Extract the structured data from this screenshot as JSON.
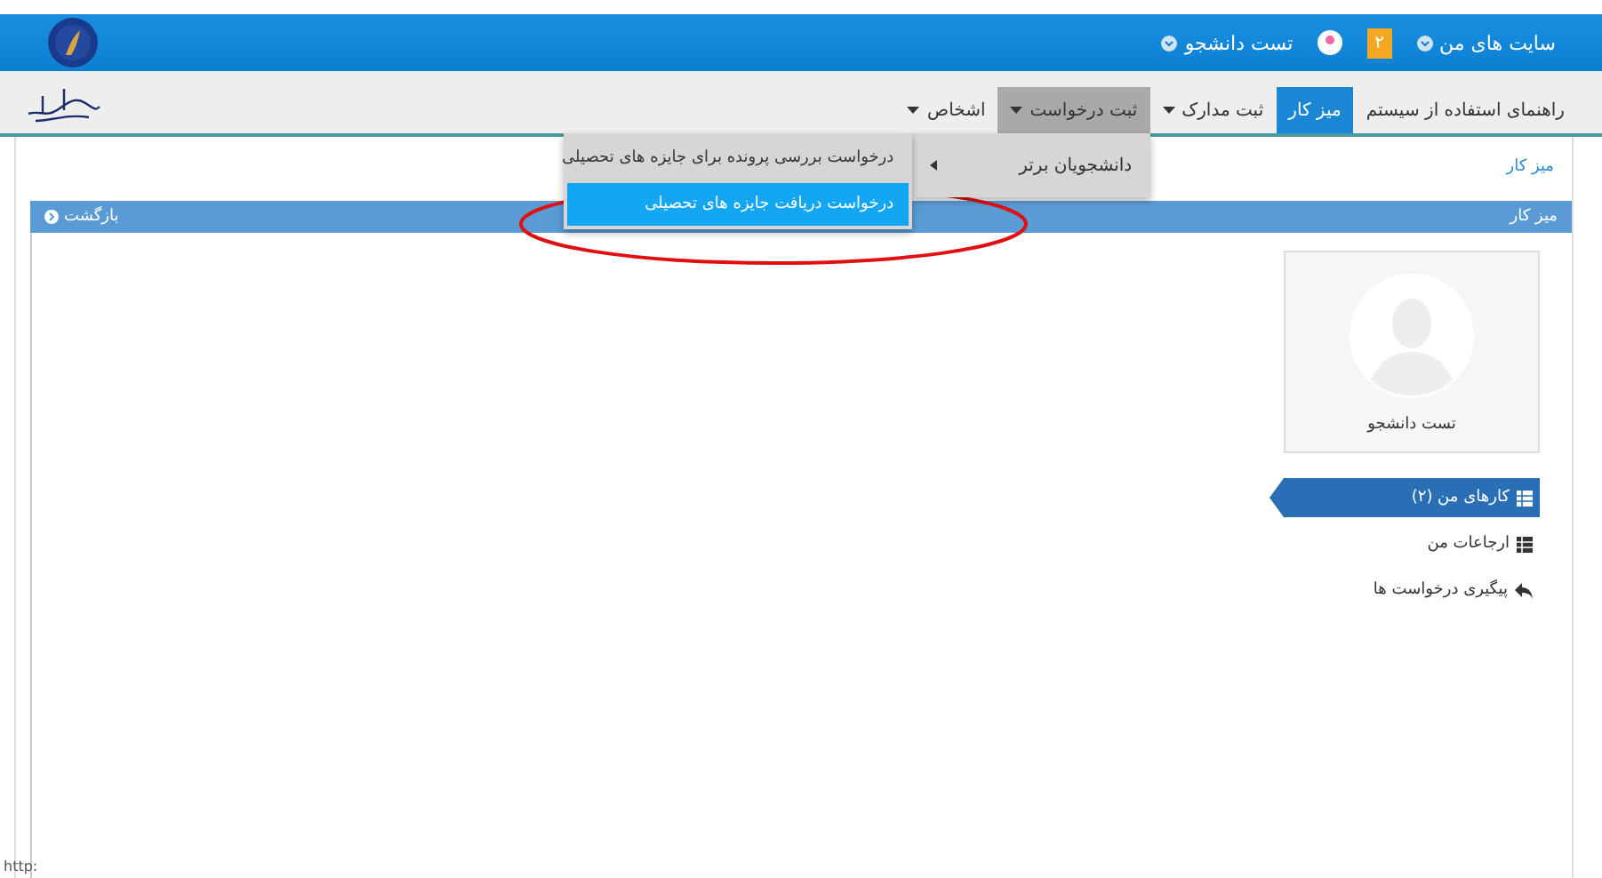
{
  "top_bar": {
    "items": [
      {
        "kind": "menu",
        "label": "سایت های من"
      },
      {
        "kind": "badge",
        "label": "۲"
      },
      {
        "kind": "user",
        "label": "تست دانشجو"
      }
    ]
  },
  "nav": {
    "tabs": [
      {
        "label": "راهنمای استفاده از سیستم",
        "selected": false,
        "dropdown": false,
        "open": false
      },
      {
        "label": "میز کار",
        "selected": true,
        "dropdown": false,
        "open": false
      },
      {
        "label": "ثبت مدارک",
        "selected": false,
        "dropdown": true,
        "open": false
      },
      {
        "label": "ثبت درخواست",
        "selected": false,
        "dropdown": true,
        "open": true
      },
      {
        "label": "اشخاص",
        "selected": false,
        "dropdown": true,
        "open": false
      }
    ]
  },
  "dropdown_menu": {
    "items": [
      {
        "label": "دانشجویان برتر",
        "submenu": [
          {
            "label": "درخواست بررسی پرونده برای جایزه های تحصیلی",
            "selected": false
          },
          {
            "label": "درخواست دریافت جایزه های تحصیلی",
            "selected": true
          }
        ]
      }
    ]
  },
  "breadcrumb": "میز کار",
  "panel": {
    "title": "میز کار",
    "back_button": "بازگشت"
  },
  "profile": {
    "name": "تست دانشجو"
  },
  "side_menu": {
    "items": [
      {
        "kind": "list",
        "label": "کارهای من (۲)",
        "selected": true
      },
      {
        "kind": "list",
        "label": "ارجاعات من",
        "selected": false
      },
      {
        "kind": "reply",
        "label": "پیگیری درخواست ها",
        "selected": false
      }
    ]
  },
  "status_bar": "http:"
}
